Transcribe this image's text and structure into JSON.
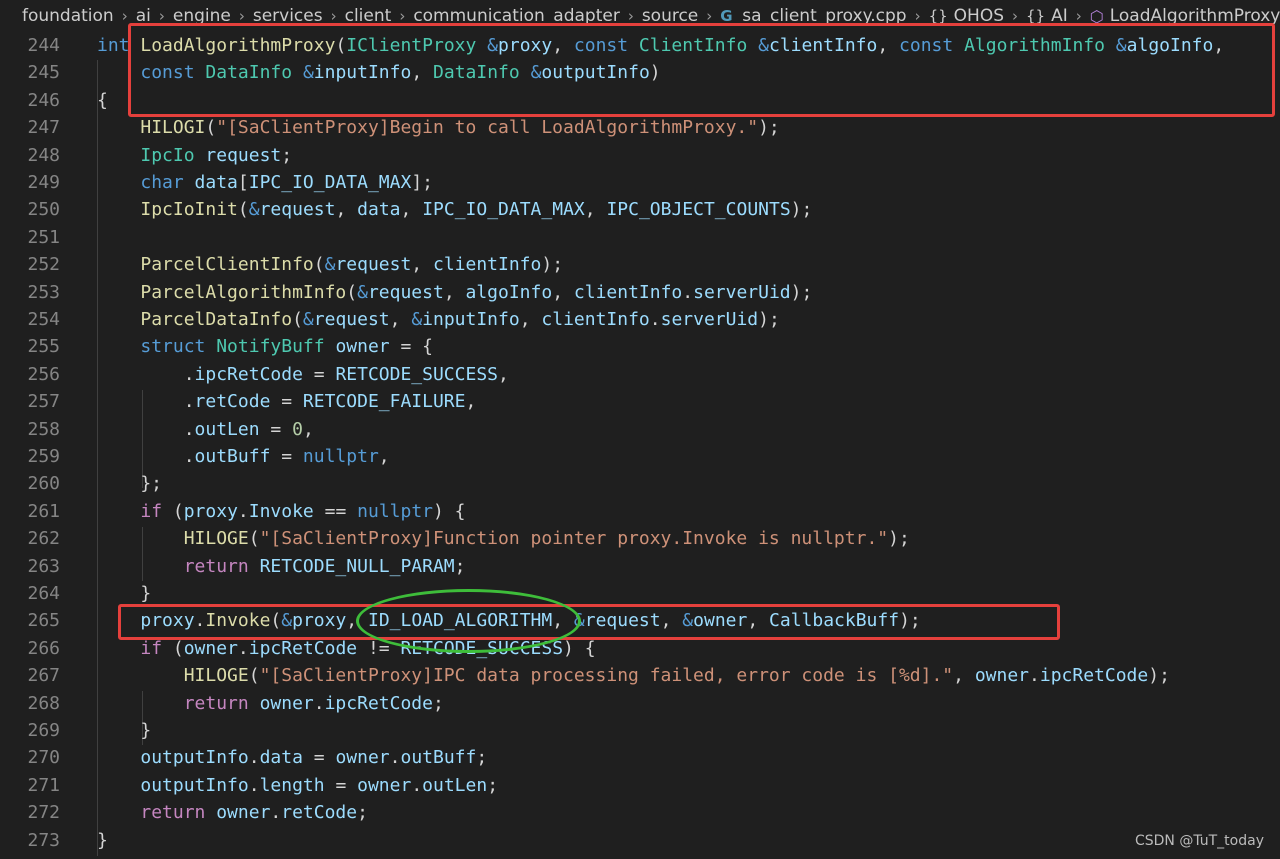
{
  "breadcrumb": {
    "items": [
      "foundation",
      "ai",
      "engine",
      "services",
      "client",
      "communication_adapter",
      "source",
      "sa_client_proxy.cpp",
      "OHOS",
      "AI",
      "LoadAlgorithmProxy"
    ]
  },
  "editor": {
    "line_numbers": [
      "244",
      "245",
      "246",
      "247",
      "248",
      "249",
      "250",
      "251",
      "252",
      "253",
      "254",
      "255",
      "256",
      "257",
      "258",
      "259",
      "260",
      "261",
      "262",
      "263",
      "264",
      "265",
      "266",
      "267",
      "268",
      "269",
      "270",
      "271",
      "272",
      "273"
    ],
    "lines": [
      [
        [
          "kw",
          "int "
        ],
        [
          "fn",
          "LoadAlgorithmProxy"
        ],
        [
          "plain",
          "("
        ],
        [
          "ty",
          "IClientProxy "
        ],
        [
          "kw",
          "&"
        ],
        [
          "var",
          "proxy"
        ],
        [
          "plain",
          ", "
        ],
        [
          "kw",
          "const "
        ],
        [
          "ty",
          "ClientInfo "
        ],
        [
          "kw",
          "&"
        ],
        [
          "var",
          "clientInfo"
        ],
        [
          "plain",
          ", "
        ],
        [
          "kw",
          "const "
        ],
        [
          "ty",
          "AlgorithmInfo "
        ],
        [
          "kw",
          "&"
        ],
        [
          "var",
          "algoInfo"
        ],
        [
          "plain",
          ","
        ]
      ],
      [
        [
          "plain",
          "    "
        ],
        [
          "kw",
          "const "
        ],
        [
          "ty",
          "DataInfo "
        ],
        [
          "kw",
          "&"
        ],
        [
          "var",
          "inputInfo"
        ],
        [
          "plain",
          ", "
        ],
        [
          "ty",
          "DataInfo "
        ],
        [
          "kw",
          "&"
        ],
        [
          "var",
          "outputInfo"
        ],
        [
          "plain",
          ")"
        ]
      ],
      [
        [
          "plain",
          "{"
        ]
      ],
      [
        [
          "plain",
          "    "
        ],
        [
          "fn",
          "HILOGI"
        ],
        [
          "plain",
          "("
        ],
        [
          "str",
          "\"[SaClientProxy]Begin to call LoadAlgorithmProxy.\""
        ],
        [
          "plain",
          ");"
        ]
      ],
      [
        [
          "plain",
          "    "
        ],
        [
          "ty",
          "IpcIo "
        ],
        [
          "var",
          "request"
        ],
        [
          "plain",
          ";"
        ]
      ],
      [
        [
          "plain",
          "    "
        ],
        [
          "kw",
          "char "
        ],
        [
          "var",
          "data"
        ],
        [
          "plain",
          "["
        ],
        [
          "var",
          "IPC_IO_DATA_MAX"
        ],
        [
          "plain",
          "];"
        ]
      ],
      [
        [
          "plain",
          "    "
        ],
        [
          "fn",
          "IpcIoInit"
        ],
        [
          "plain",
          "("
        ],
        [
          "kw",
          "&"
        ],
        [
          "var",
          "request"
        ],
        [
          "plain",
          ", "
        ],
        [
          "var",
          "data"
        ],
        [
          "plain",
          ", "
        ],
        [
          "var",
          "IPC_IO_DATA_MAX"
        ],
        [
          "plain",
          ", "
        ],
        [
          "var",
          "IPC_OBJECT_COUNTS"
        ],
        [
          "plain",
          ");"
        ]
      ],
      [
        [
          "plain",
          ""
        ]
      ],
      [
        [
          "plain",
          "    "
        ],
        [
          "fn",
          "ParcelClientInfo"
        ],
        [
          "plain",
          "("
        ],
        [
          "kw",
          "&"
        ],
        [
          "var",
          "request"
        ],
        [
          "plain",
          ", "
        ],
        [
          "var",
          "clientInfo"
        ],
        [
          "plain",
          ");"
        ]
      ],
      [
        [
          "plain",
          "    "
        ],
        [
          "fn",
          "ParcelAlgorithmInfo"
        ],
        [
          "plain",
          "("
        ],
        [
          "kw",
          "&"
        ],
        [
          "var",
          "request"
        ],
        [
          "plain",
          ", "
        ],
        [
          "var",
          "algoInfo"
        ],
        [
          "plain",
          ", "
        ],
        [
          "var",
          "clientInfo"
        ],
        [
          "plain",
          "."
        ],
        [
          "var",
          "serverUid"
        ],
        [
          "plain",
          ");"
        ]
      ],
      [
        [
          "plain",
          "    "
        ],
        [
          "fn",
          "ParcelDataInfo"
        ],
        [
          "plain",
          "("
        ],
        [
          "kw",
          "&"
        ],
        [
          "var",
          "request"
        ],
        [
          "plain",
          ", "
        ],
        [
          "kw",
          "&"
        ],
        [
          "var",
          "inputInfo"
        ],
        [
          "plain",
          ", "
        ],
        [
          "var",
          "clientInfo"
        ],
        [
          "plain",
          "."
        ],
        [
          "var",
          "serverUid"
        ],
        [
          "plain",
          ");"
        ]
      ],
      [
        [
          "plain",
          "    "
        ],
        [
          "kw",
          "struct "
        ],
        [
          "ty",
          "NotifyBuff "
        ],
        [
          "var",
          "owner"
        ],
        [
          "plain",
          " = {"
        ]
      ],
      [
        [
          "plain",
          "        ."
        ],
        [
          "var",
          "ipcRetCode"
        ],
        [
          "plain",
          " = "
        ],
        [
          "var",
          "RETCODE_SUCCESS"
        ],
        [
          "plain",
          ","
        ]
      ],
      [
        [
          "plain",
          "        ."
        ],
        [
          "var",
          "retCode"
        ],
        [
          "plain",
          " = "
        ],
        [
          "var",
          "RETCODE_FAILURE"
        ],
        [
          "plain",
          ","
        ]
      ],
      [
        [
          "plain",
          "        ."
        ],
        [
          "var",
          "outLen"
        ],
        [
          "plain",
          " = "
        ],
        [
          "num",
          "0"
        ],
        [
          "plain",
          ","
        ]
      ],
      [
        [
          "plain",
          "        ."
        ],
        [
          "var",
          "outBuff"
        ],
        [
          "plain",
          " = "
        ],
        [
          "kw",
          "nullptr"
        ],
        [
          "plain",
          ","
        ]
      ],
      [
        [
          "plain",
          "    };"
        ]
      ],
      [
        [
          "plain",
          "    "
        ],
        [
          "ctl",
          "if "
        ],
        [
          "plain",
          "("
        ],
        [
          "var",
          "proxy"
        ],
        [
          "plain",
          "."
        ],
        [
          "var",
          "Invoke"
        ],
        [
          "plain",
          " == "
        ],
        [
          "kw",
          "nullptr"
        ],
        [
          "plain",
          ") {"
        ]
      ],
      [
        [
          "plain",
          "        "
        ],
        [
          "fn",
          "HILOGE"
        ],
        [
          "plain",
          "("
        ],
        [
          "str",
          "\"[SaClientProxy]Function pointer proxy.Invoke is nullptr.\""
        ],
        [
          "plain",
          ");"
        ]
      ],
      [
        [
          "plain",
          "        "
        ],
        [
          "ctl",
          "return "
        ],
        [
          "var",
          "RETCODE_NULL_PARAM"
        ],
        [
          "plain",
          ";"
        ]
      ],
      [
        [
          "plain",
          "    }"
        ]
      ],
      [
        [
          "plain",
          "    "
        ],
        [
          "var",
          "proxy"
        ],
        [
          "plain",
          "."
        ],
        [
          "fn",
          "Invoke"
        ],
        [
          "plain",
          "("
        ],
        [
          "kw",
          "&"
        ],
        [
          "var",
          "proxy"
        ],
        [
          "plain",
          ", "
        ],
        [
          "var",
          "ID_LOAD_ALGORITHM"
        ],
        [
          "plain",
          ", "
        ],
        [
          "kw",
          "&"
        ],
        [
          "var",
          "request"
        ],
        [
          "plain",
          ", "
        ],
        [
          "kw",
          "&"
        ],
        [
          "var",
          "owner"
        ],
        [
          "plain",
          ", "
        ],
        [
          "var",
          "CallbackBuff"
        ],
        [
          "plain",
          ");"
        ]
      ],
      [
        [
          "plain",
          "    "
        ],
        [
          "ctl",
          "if "
        ],
        [
          "plain",
          "("
        ],
        [
          "var",
          "owner"
        ],
        [
          "plain",
          "."
        ],
        [
          "var",
          "ipcRetCode"
        ],
        [
          "plain",
          " != "
        ],
        [
          "var",
          "RETCODE_SUCCESS"
        ],
        [
          "plain",
          ") {"
        ]
      ],
      [
        [
          "plain",
          "        "
        ],
        [
          "fn",
          "HILOGE"
        ],
        [
          "plain",
          "("
        ],
        [
          "str",
          "\"[SaClientProxy]IPC data processing failed, error code is [%d].\""
        ],
        [
          "plain",
          ", "
        ],
        [
          "var",
          "owner"
        ],
        [
          "plain",
          "."
        ],
        [
          "var",
          "ipcRetCode"
        ],
        [
          "plain",
          ");"
        ]
      ],
      [
        [
          "plain",
          "        "
        ],
        [
          "ctl",
          "return "
        ],
        [
          "var",
          "owner"
        ],
        [
          "plain",
          "."
        ],
        [
          "var",
          "ipcRetCode"
        ],
        [
          "plain",
          ";"
        ]
      ],
      [
        [
          "plain",
          "    }"
        ]
      ],
      [
        [
          "plain",
          "    "
        ],
        [
          "var",
          "outputInfo"
        ],
        [
          "plain",
          "."
        ],
        [
          "var",
          "data"
        ],
        [
          "plain",
          " = "
        ],
        [
          "var",
          "owner"
        ],
        [
          "plain",
          "."
        ],
        [
          "var",
          "outBuff"
        ],
        [
          "plain",
          ";"
        ]
      ],
      [
        [
          "plain",
          "    "
        ],
        [
          "var",
          "outputInfo"
        ],
        [
          "plain",
          "."
        ],
        [
          "var",
          "length"
        ],
        [
          "plain",
          " = "
        ],
        [
          "var",
          "owner"
        ],
        [
          "plain",
          "."
        ],
        [
          "var",
          "outLen"
        ],
        [
          "plain",
          ";"
        ]
      ],
      [
        [
          "plain",
          "    "
        ],
        [
          "ctl",
          "return "
        ],
        [
          "var",
          "owner"
        ],
        [
          "plain",
          "."
        ],
        [
          "var",
          "retCode"
        ],
        [
          "plain",
          ";"
        ]
      ],
      [
        [
          "plain",
          "}"
        ]
      ]
    ]
  },
  "colors": {
    "background": "#1f1f1f",
    "keyword": "#569cd6",
    "control": "#c586c0",
    "function": "#dcdcaa",
    "type": "#4ec9b0",
    "variable": "#9cdcfe",
    "string": "#ce9178",
    "number": "#b5cea8",
    "annotation_red": "#e5403c",
    "annotation_green": "#3ebd3a"
  },
  "watermark": {
    "text": "CSDN @TuT_today"
  }
}
